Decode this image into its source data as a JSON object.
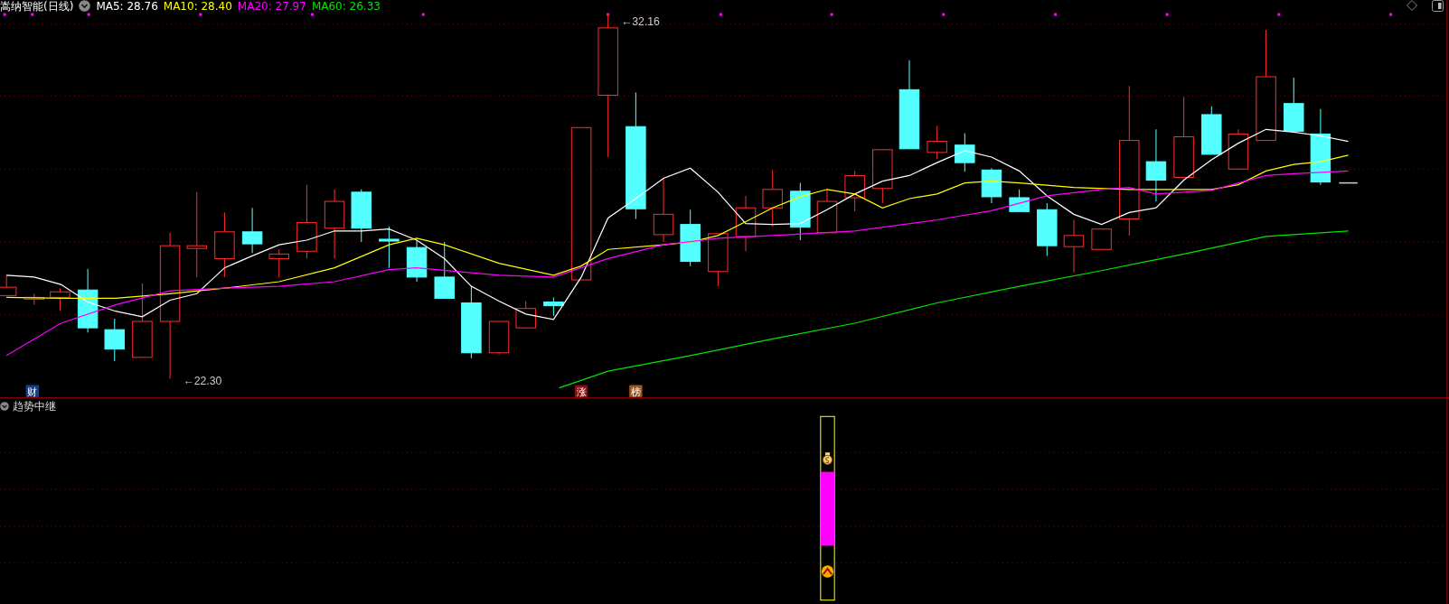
{
  "header": {
    "title": "嵩纳智能(日线)"
  },
  "ma_legend": [
    {
      "label": "MA5: 28.76",
      "color": "#ffffff"
    },
    {
      "label": "MA10: 28.40",
      "color": "#ffff00"
    },
    {
      "label": "MA20: 27.97",
      "color": "#ff00ff"
    },
    {
      "label": "MA60: 26.33",
      "color": "#00e600"
    }
  ],
  "price_labels": [
    {
      "kind": "high",
      "text": "←32.16"
    },
    {
      "kind": "low",
      "text": "←22.30"
    }
  ],
  "event_markers": [
    {
      "text": "财",
      "color": "#1c3f8a"
    },
    {
      "text": "涨",
      "color": "#8a1010"
    },
    {
      "text": "榜",
      "color": "#a0561c"
    }
  ],
  "indicator_panel": {
    "title": "趋势中继"
  }
}
